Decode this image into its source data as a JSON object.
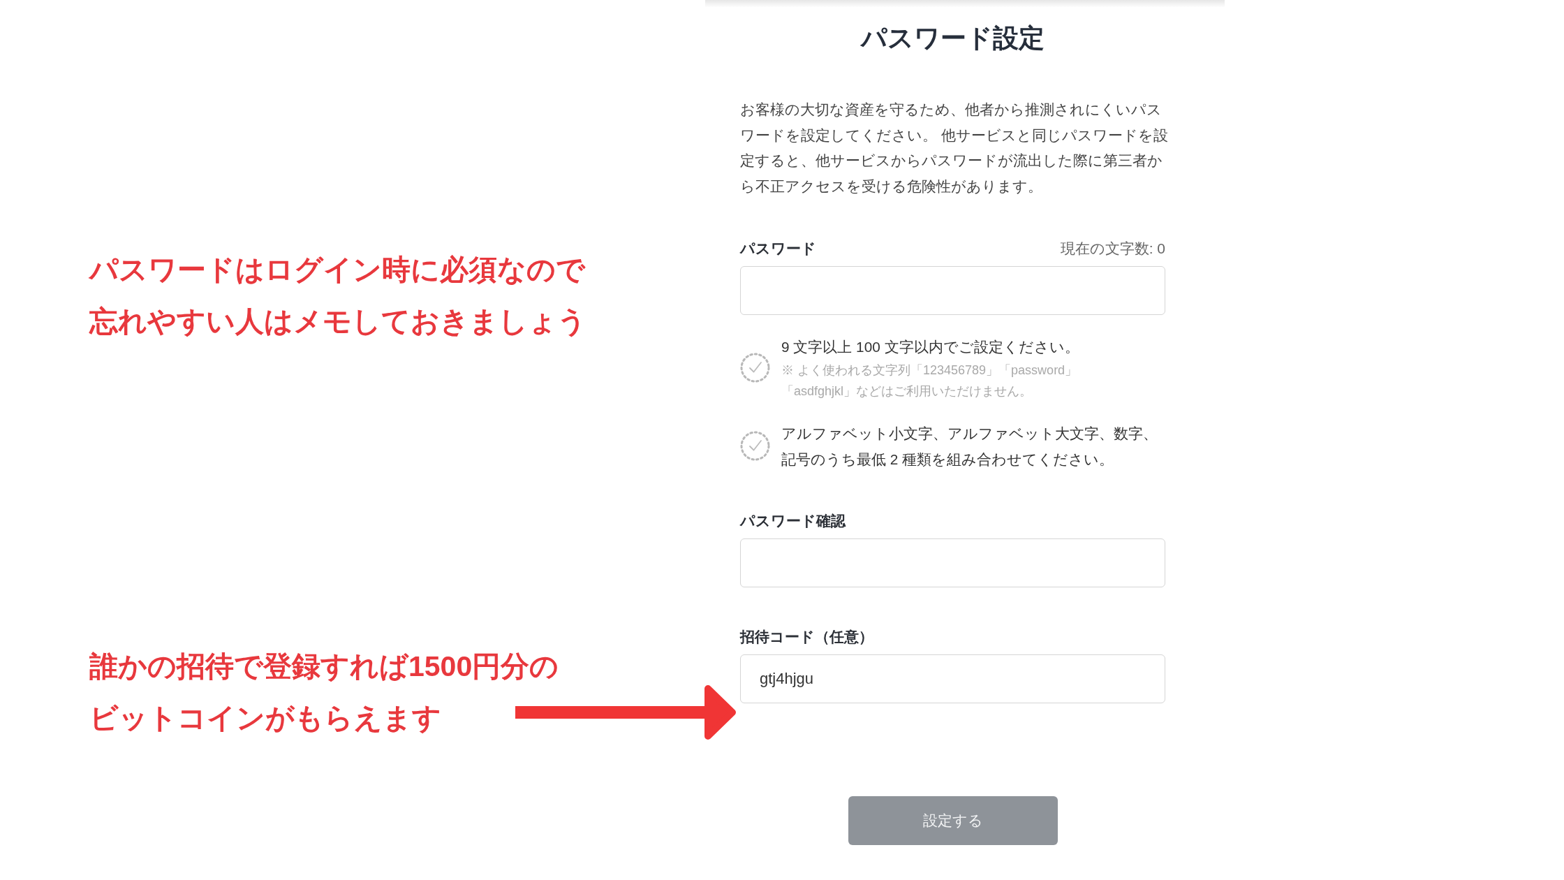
{
  "annotations": [
    {
      "kind": "plain",
      "lines": [
        "パスワードはログイン時に必須なので",
        "忘れやすい人はメモしておきましょう"
      ]
    },
    {
      "kind": "arrow",
      "lines": [
        "誰かの招待で登録すれば1500円分の",
        "ビットコインがもらえます"
      ]
    }
  ],
  "form": {
    "title": "パスワード設定",
    "description": "お客様の大切な資産を守るため、他者から推測されにくいパスワードを設定してください。 他サービスと同じパスワードを設定すると、他サービスからパスワードが流出した際に第三者から不正アクセスを受ける危険性があります。",
    "password": {
      "label": "パスワード",
      "counter": "現在の文字数: 0"
    },
    "rules": [
      {
        "text": "9 文字以上 100 文字以内でご設定ください。",
        "note": "※ よく使われる文字列「123456789」「password」「asdfghjkl」などはご利用いただけません。",
        "checked": false
      },
      {
        "text": "アルファベット小文字、アルファベット大文字、数字、記号のうち最低 2 種類を組み合わせてください。",
        "checked": false
      }
    ],
    "confirm": {
      "label": "パスワード確認"
    },
    "invite": {
      "label": "招待コード（任意）",
      "value": "gtj4hjgu"
    },
    "submit": {
      "label": "設定する",
      "disabled": true
    }
  }
}
